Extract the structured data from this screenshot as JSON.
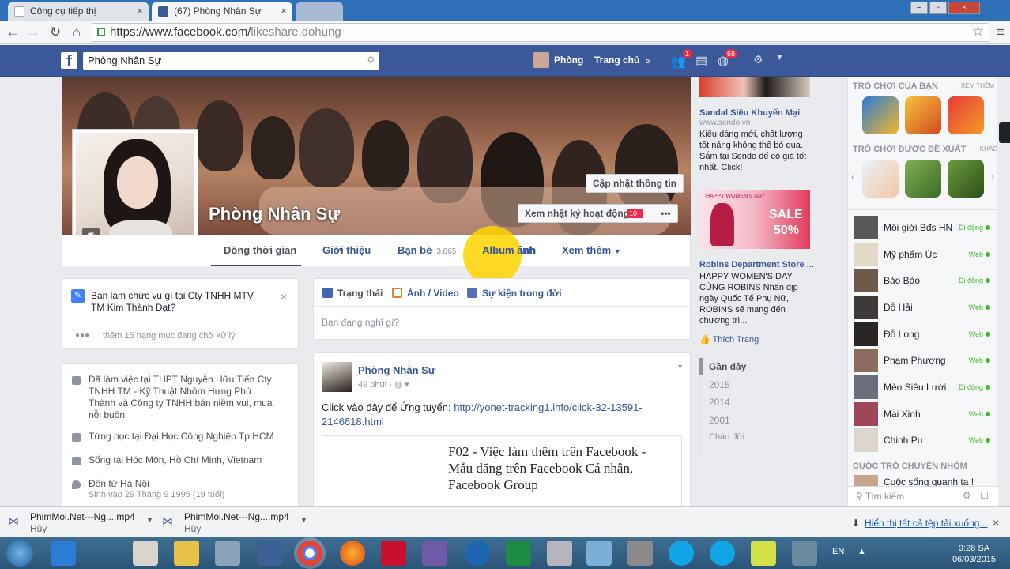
{
  "browser": {
    "tabs": [
      {
        "title": "Công cụ tiếp thị",
        "active": false
      },
      {
        "title": "(67) Phòng Nhân Sự",
        "active": true
      },
      {
        "title": "",
        "active": false
      }
    ],
    "url_prefix": "https://www.facebook.com/",
    "url_path": "likeshare.dohung",
    "window_buttons": [
      "–",
      "▫",
      "×"
    ]
  },
  "fbbar": {
    "search_value": "Phòng Nhân Sự",
    "user_name": "Phòng",
    "home_label": "Trang chủ",
    "home_count": "5",
    "friend_badge": "1",
    "notif_badge": "68"
  },
  "profile": {
    "name": "Phòng Nhân Sự",
    "update_info": "Cập nhật thông tin",
    "activity_log": "Xem nhật ký hoạt động",
    "activity_badge": "10+",
    "nav": [
      {
        "label": "Dòng thời gian"
      },
      {
        "label": "Giới thiệu"
      },
      {
        "label": "Bạn bè",
        "count": "3.865"
      },
      {
        "label": "Album ảnh"
      },
      {
        "label": "Xem thêm"
      }
    ]
  },
  "prompt_card": {
    "question": "Bạn làm chức vụ gì tại Cty TNHH MTV TM Kim Thành Đạt?",
    "pending": "thêm 15 hạng mục đang chờ xử lý"
  },
  "about": [
    {
      "icon": "briefcase-icon",
      "text": "Đã làm việc tại THPT Nguyễn Hữu Tiến Cty TNHH TM - Kỹ Thuật Nhôm Hưng Phú Thành và Công ty TNHH bán niềm vui, mua nỗi buồn"
    },
    {
      "icon": "graduation-cap-icon",
      "text": "Từng học tại Đại Học Công Nghiệp Tp.HCM"
    },
    {
      "icon": "home-icon",
      "text": "Sống tại Hóc Môn, Hồ Chí Minh, Vietnam"
    },
    {
      "icon": "location-pin-icon",
      "text": "Đến từ Hà Nội"
    },
    {
      "icon": "",
      "text": "Sinh vào 29 Tháng 9 1995 (19 tuổi)"
    }
  ],
  "composer": {
    "tabs": [
      "Trạng thái",
      "Ảnh / Video",
      "Sự kiện trong đời"
    ],
    "placeholder": "Bạn đang nghĩ gì?"
  },
  "post": {
    "author": "Phòng Nhân Sự",
    "time": "49 phút",
    "text_prefix": "Click vào đây để Ứng tuyển: ",
    "link": "http://yonet-tracking1.info/click-32-13591-2146618.html",
    "link_line1": "http://yonet-tracking1.info/click-32-13591-",
    "link_line2": "2146618.html",
    "preview_title": "F02 - Việc làm thêm trên Facebook - Mẫu đăng trên Facebook Cá nhân, Facebook Group"
  },
  "ads": [
    {
      "title": "Sandal Siêu Khuyến Mại",
      "domain": "www.sendo.vn",
      "text": "Kiểu dáng mới, chất lượng tốt nâng không thể bỏ qua. Sắm tại Sendo để có giá tốt nhất. Click!",
      "brand": "sendo"
    },
    {
      "title": "Robins Department Store ...",
      "domain": "",
      "text": "HAPPY WOMEN'S DAY CÙNG ROBINS Nhân dịp ngày Quốc Tế Phụ Nữ, ROBINS sẽ mang đến chương trì...",
      "banner_top": "HAPPY WOMEN'S DAY",
      "banner_sale": "SALE",
      "banner_pct": "50%"
    }
  ],
  "like_page": "Thích Trang",
  "timeline_years": {
    "header": "Gần đây",
    "years": [
      "2015",
      "2014",
      "2001",
      "Chào đời"
    ]
  },
  "chat": {
    "games_head": "TRÒ CHƠI CỦA BẠN",
    "games_more": "XEM THÊM",
    "suggested_head": "TRÒ CHƠI ĐƯỢC ĐỀ XUẤT",
    "suggested_more": "KHÁC",
    "friends": [
      {
        "name": "Môi giới Bđs HN",
        "status": "Di động"
      },
      {
        "name": "Mỹ phẩm Úc",
        "status": "Web"
      },
      {
        "name": "Bảo Bảo",
        "status": "Di động"
      },
      {
        "name": "Đỗ Hải",
        "status": "Web"
      },
      {
        "name": "Đỗ Long",
        "status": "Web"
      },
      {
        "name": "Phạm Phương",
        "status": "Web"
      },
      {
        "name": "Mèo Siêu Lười",
        "status": "Di động"
      },
      {
        "name": "Mai Xinh",
        "status": "Web"
      },
      {
        "name": "Chinh Pu",
        "status": "Web"
      }
    ],
    "group_head": "CUỘC TRÒ CHUYỆN NHÓM",
    "group_name": "Cuộc sống quanh ta !",
    "search_placeholder": "Tìm kiếm"
  },
  "downloads": {
    "items": [
      {
        "name": "PhimMoi.Net---Ng....mp4",
        "status": "Hủy"
      },
      {
        "name": "PhimMoi.Net---Ng....mp4",
        "status": "Hủy"
      }
    ],
    "show_all": "Hiển thị tất cả tệp tải xuống..."
  },
  "taskbar": {
    "lang": "EN",
    "time": "9:28 SA",
    "date": "06/03/2015"
  },
  "colors": {
    "fb_blue": "#3b5998",
    "link": "#365899",
    "online": "#42b72a",
    "badge": "#f02849",
    "highlight": "#ffd400"
  }
}
